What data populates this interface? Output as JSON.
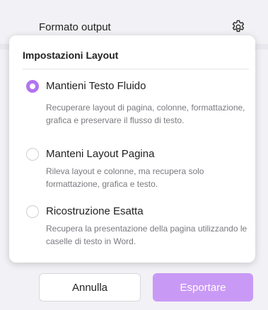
{
  "header": {
    "label": "Formato output",
    "settings_icon": "gear-icon"
  },
  "popup": {
    "title": "Impostazioni Layout",
    "options": [
      {
        "title": "Mantieni Testo Fluido",
        "description": "Recuperare layout di pagina, colonne, formattazione, grafica e preservare il flusso di testo.",
        "selected": true
      },
      {
        "title": "Manteni Layout Pagina",
        "description": "Rileva layout e colonne, ma recupera solo formattazione, grafica e testo.",
        "selected": false
      },
      {
        "title": "Ricostruzione Esatta",
        "description": "Recupera la presentazione della pagina utilizzando le caselle di testo in Word.",
        "selected": false
      }
    ]
  },
  "footer": {
    "cancel_label": "Annulla",
    "export_label": "Esportare"
  },
  "colors": {
    "accent": "#b273f0",
    "export_button": "#c99af5"
  }
}
